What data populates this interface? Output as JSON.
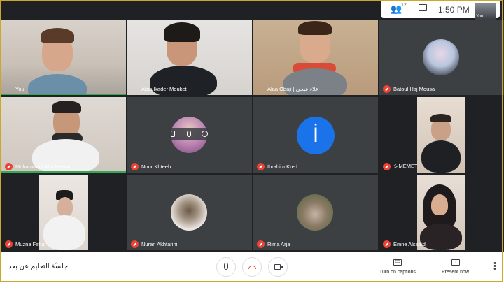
{
  "topbar": {
    "participants_count": "12",
    "time": "1:50  PM",
    "self_label": "You",
    "icons": [
      "people-icon",
      "chat-icon"
    ]
  },
  "tiles": [
    {
      "name": "You",
      "muted": false,
      "speaking": true
    },
    {
      "name": "Abdulkader Mouket",
      "muted": false
    },
    {
      "name": "Alaa Obaji | علاء عبجي",
      "muted": false
    },
    {
      "name": "Batoul Haj Mousa",
      "muted": true
    },
    {
      "name": "Mohammad Abu Hasna",
      "muted": true
    },
    {
      "name": "Nour Khteeb",
      "muted": true
    },
    {
      "name": "İbrahim Kred",
      "muted": true,
      "initial": "İ"
    },
    {
      "name": "シMEMET",
      "muted": true
    },
    {
      "name": "Muzna Fattal",
      "muted": true
    },
    {
      "name": "Nuran Akhtarini",
      "muted": true
    },
    {
      "name": "Rima Arja",
      "muted": true
    },
    {
      "name": "Emne Alsaaid",
      "muted": true
    }
  ],
  "bottombar": {
    "meeting_name": "جلسة التعليم عن بعد",
    "captions_label": "Turn on captions",
    "present_label": "Present now",
    "icons": [
      "mic-icon",
      "end-call-icon",
      "camera-icon",
      "captions-icon",
      "present-icon",
      "more-icon"
    ]
  },
  "colors": {
    "accent": "#8ab4f8",
    "muted": "#ea4335",
    "speaking": "#34a853",
    "tile_bg": "#3c4043",
    "avatar_blue": "#1a73e8"
  }
}
